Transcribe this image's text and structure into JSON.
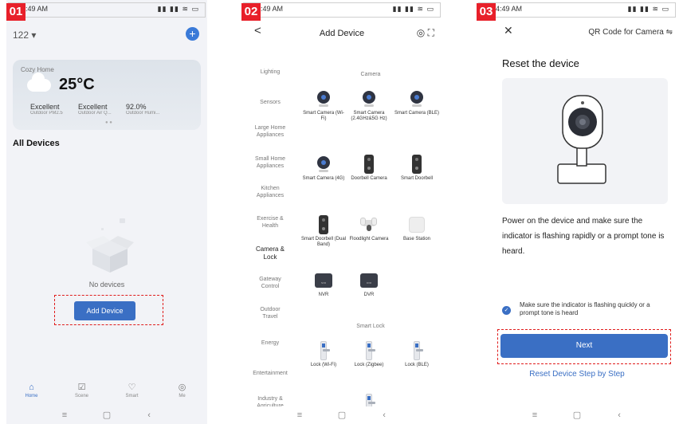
{
  "badges": [
    "01",
    "02",
    "03"
  ],
  "status": {
    "time": "49 AM",
    "time_partial": ":49 AM",
    "time_p3": "4:49 AM",
    "icons": "▮▮ ▮▮ ≋ ▭"
  },
  "navbar": {
    "menu": "≡",
    "home": "▢",
    "back": "‹"
  },
  "panel1": {
    "home_name": "122 ▾",
    "add_icon": "+",
    "weather": {
      "location": "Cozy Home",
      "temperature": "25°C",
      "stats": [
        {
          "value": "Excellent",
          "label": "Outdoor PM2.5"
        },
        {
          "value": "Excellent",
          "label": "Outdoor Air Q..."
        },
        {
          "value": "92.0%",
          "label": "Outdoor Humi..."
        }
      ],
      "pager": "● ●"
    },
    "section_title": "All Devices",
    "empty_text": "No devices",
    "add_device_label": "Add Device",
    "tabs": [
      {
        "icon": "⌂",
        "label": "Home",
        "active": true
      },
      {
        "icon": "☑",
        "label": "Scene",
        "active": false
      },
      {
        "icon": "♡",
        "label": "Smart",
        "active": false
      },
      {
        "icon": "◎",
        "label": "Me",
        "active": false
      }
    ]
  },
  "panel2": {
    "back": "<",
    "title": "Add Device",
    "top_icons": "◎  ⛶",
    "categories": [
      "Lighting",
      "Sensors",
      "Large Home Appliances",
      "Small Home Appliances",
      "Kitchen Appliances",
      "Exercise & Health",
      "Camera & Lock",
      "Gateway Control",
      "Outdoor Travel",
      "Energy",
      "Entertainment",
      "Industry & Agriculture"
    ],
    "active_category": "Camera & Lock",
    "groups": {
      "camera": "Camera",
      "smart_lock": "Smart Lock"
    },
    "devices": [
      {
        "label": "Smart Camera (Wi-Fi)",
        "icon": "camera-icon"
      },
      {
        "label": "Smart Camera (2.4GHz&5G Hz)",
        "icon": "camera-icon"
      },
      {
        "label": "Smart Camera (BLE)",
        "icon": "camera-icon"
      },
      {
        "label": "Smart Camera (4G)",
        "icon": "camera-icon"
      },
      {
        "label": "Doorbell Camera",
        "icon": "doorbell-icon"
      },
      {
        "label": "Smart Doorbell",
        "icon": "doorbell-icon"
      },
      {
        "label": "Smart Doorbell (Dual Band)",
        "icon": "doorbell-icon"
      },
      {
        "label": "Floodlight Camera",
        "icon": "floodlight-icon"
      },
      {
        "label": "Base Station",
        "icon": "base-station-icon"
      },
      {
        "label": "NVR",
        "icon": "nvr-icon"
      },
      {
        "label": "DVR",
        "icon": "dvr-icon"
      }
    ],
    "locks": [
      {
        "label": "Lock (Wi-Fi)"
      },
      {
        "label": "Lock (Zigbee)"
      },
      {
        "label": "Lock (BLE)"
      }
    ],
    "nvr_text": "NVR",
    "dvr_text": "DVR"
  },
  "panel3": {
    "close": "✕",
    "title": "QR Code for Camera ⇋",
    "heading": "Reset the device",
    "description": "Power on the device and make sure the indicator is flashing rapidly or a prompt tone is heard.",
    "check_text": "Make sure the indicator is flashing quickly or a prompt tone is heard",
    "check_mark": "✓",
    "next_label": "Next",
    "link_label": "Reset Device Step by Step"
  },
  "colors": {
    "accent": "#3a6fc4",
    "badge": "#e8202a",
    "highlight": "#e01c1c"
  }
}
